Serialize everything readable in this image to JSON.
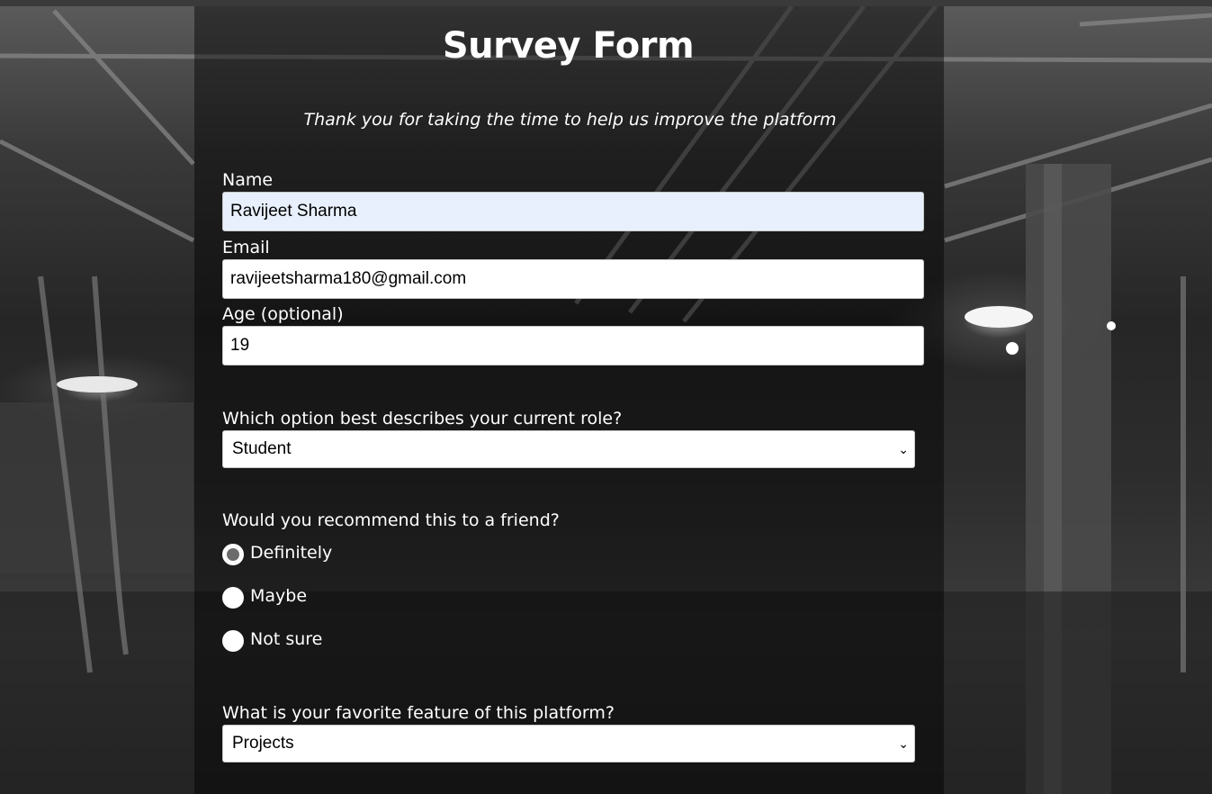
{
  "header": {
    "title": "Survey Form",
    "description": "Thank you for taking the time to help us improve the platform"
  },
  "form": {
    "name": {
      "label": "Name",
      "value": "Ravijeet Sharma"
    },
    "email": {
      "label": "Email",
      "value": "ravijeetsharma180@gmail.com"
    },
    "age": {
      "label": "Age (optional)",
      "value": "19"
    },
    "role": {
      "label": "Which option best describes your current role?",
      "selected": "Student"
    },
    "recommend": {
      "label": "Would you recommend this to a friend?",
      "options": [
        {
          "label": "Definitely",
          "checked": true
        },
        {
          "label": "Maybe",
          "checked": false
        },
        {
          "label": "Not sure",
          "checked": false
        }
      ]
    },
    "favorite_feature": {
      "label": "What is your favorite feature of this platform?",
      "selected": "Projects"
    }
  },
  "icons": {
    "dropdown": "chevron-down-icon"
  }
}
